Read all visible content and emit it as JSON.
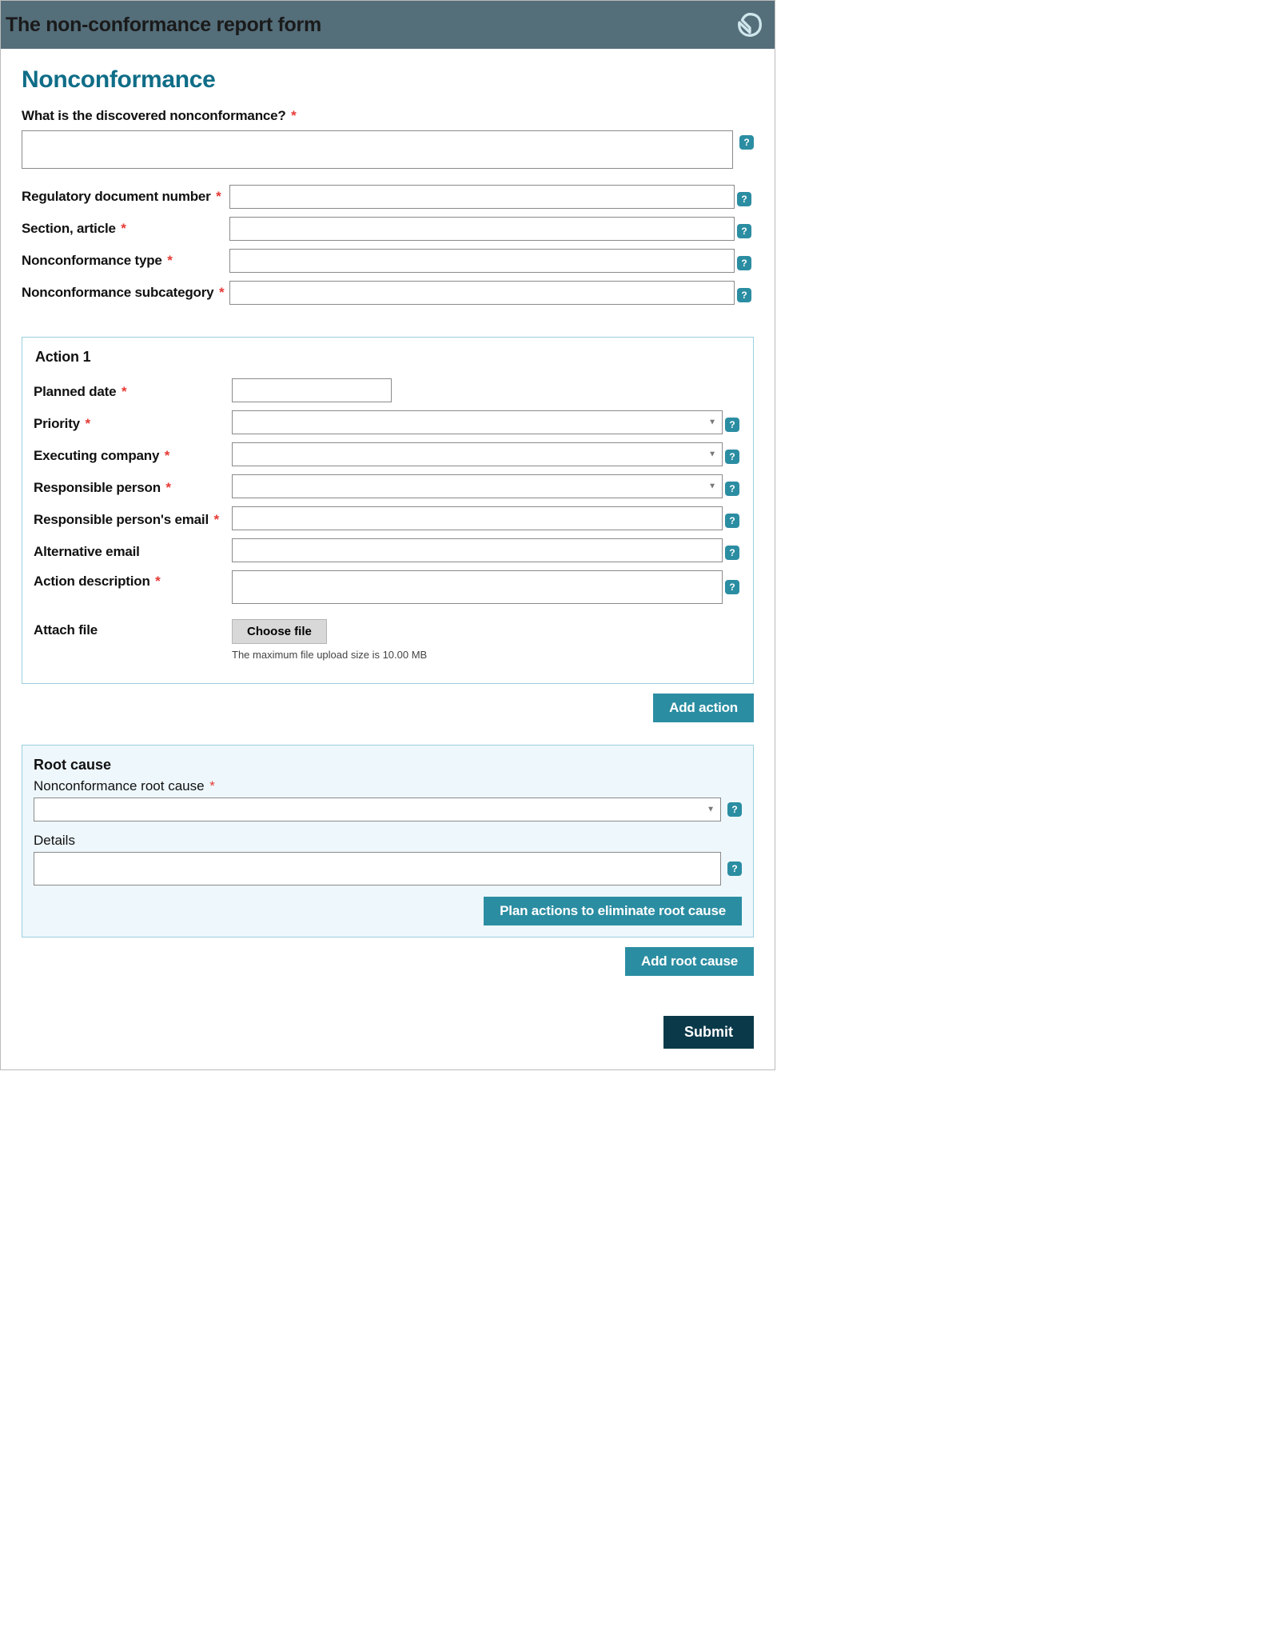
{
  "header": {
    "title": "The non-conformance report form"
  },
  "main": {
    "title": "Nonconformance",
    "nonconformance_label": "What is the discovered nonconformance?",
    "regulatory_doc_label": "Regulatory document number",
    "section_article_label": "Section, article",
    "type_label": "Nonconformance type",
    "subcategory_label": "Nonconformance subcategory",
    "required_marker": "*",
    "help_char": "?"
  },
  "action": {
    "title": "Action 1",
    "planned_date_label": "Planned date",
    "priority_label": "Priority",
    "executing_company_label": "Executing company",
    "responsible_person_label": "Responsible person",
    "responsible_email_label": "Responsible person's email",
    "alternative_email_label": "Alternative email",
    "description_label": "Action description",
    "attach_label": "Attach file",
    "choose_file_button": "Choose file",
    "file_size_note": "The maximum file upload size is 10.00 MB",
    "add_action_button": "Add action"
  },
  "root": {
    "title": "Root cause",
    "root_cause_label": "Nonconformance root cause",
    "details_label": "Details",
    "plan_button": "Plan actions to eliminate root cause",
    "add_root_button": "Add root cause"
  },
  "footer": {
    "submit_button": "Submit"
  },
  "select_caret": "▼"
}
